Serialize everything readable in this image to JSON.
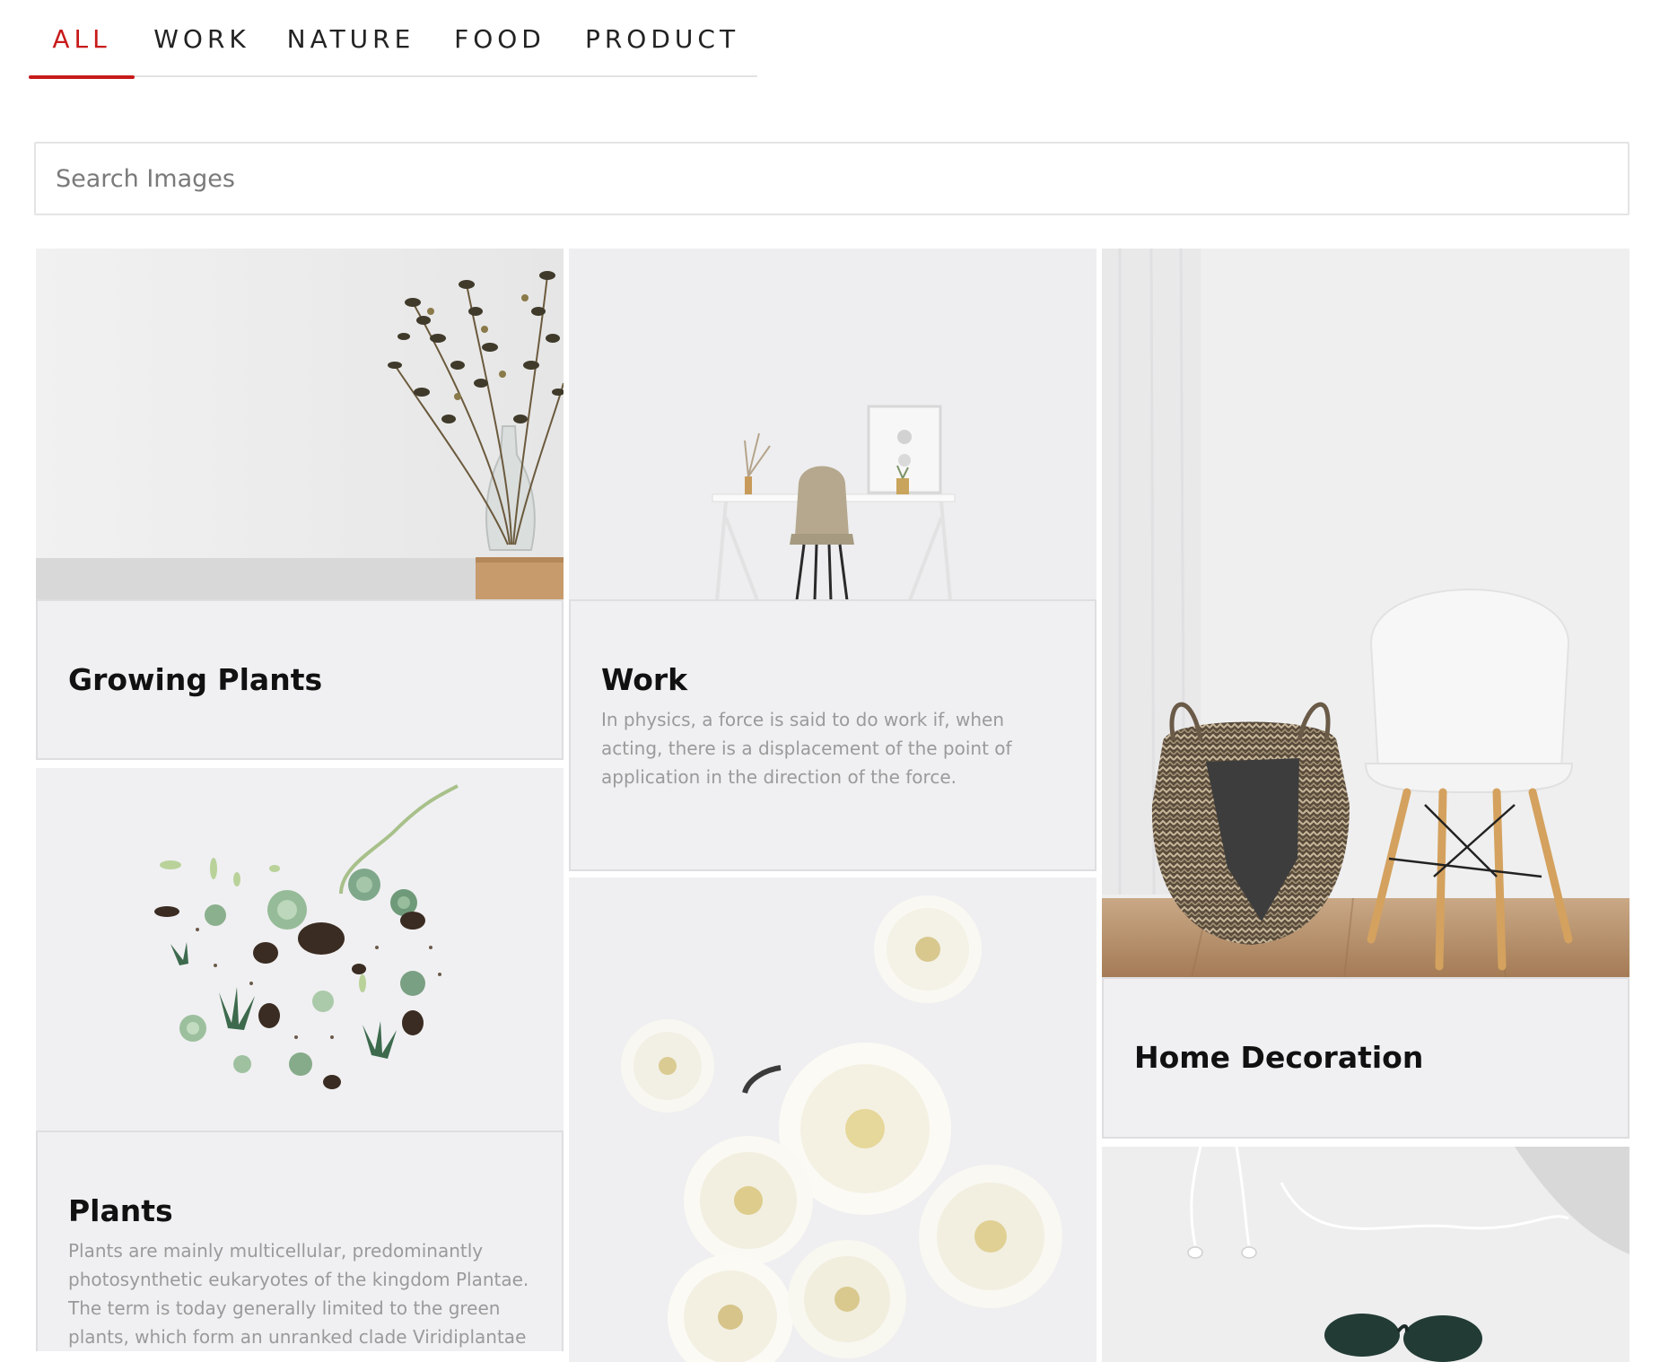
{
  "tabs": [
    {
      "label": "ALL",
      "active": true
    },
    {
      "label": "WORK",
      "active": false
    },
    {
      "label": "NATURE",
      "active": false
    },
    {
      "label": "FOOD",
      "active": false
    },
    {
      "label": "PRODUCT",
      "active": false
    }
  ],
  "colors": {
    "accent": "#c81a1a",
    "card_bg": "#f0f0f2",
    "muted_text": "#9a9a9a"
  },
  "search": {
    "placeholder": "Search Images",
    "value": ""
  },
  "cards": [
    {
      "title": "Growing Plants",
      "description": "",
      "image": "dried-flowers-in-glass-vase"
    },
    {
      "title": "Work",
      "description": "In physics, a force is said to do work if, when acting, there is a displacement of the point of application in the direction of the force.",
      "image": "white-desk-with-chair"
    },
    {
      "title": "Home Decoration",
      "description": "",
      "image": "woven-basket-and-white-chair"
    },
    {
      "title": "Plants",
      "description": "Plants are mainly multicellular, predominantly photosynthetic eukaryotes of the kingdom Plantae. The term is today generally limited to the green plants, which form an unranked clade Viridiplantae",
      "image": "succulents-flat-lay"
    },
    {
      "title": "",
      "description": "",
      "image": "white-chrysanthemums"
    },
    {
      "title": "",
      "description": "",
      "image": "earphones-and-sunglasses"
    }
  ]
}
